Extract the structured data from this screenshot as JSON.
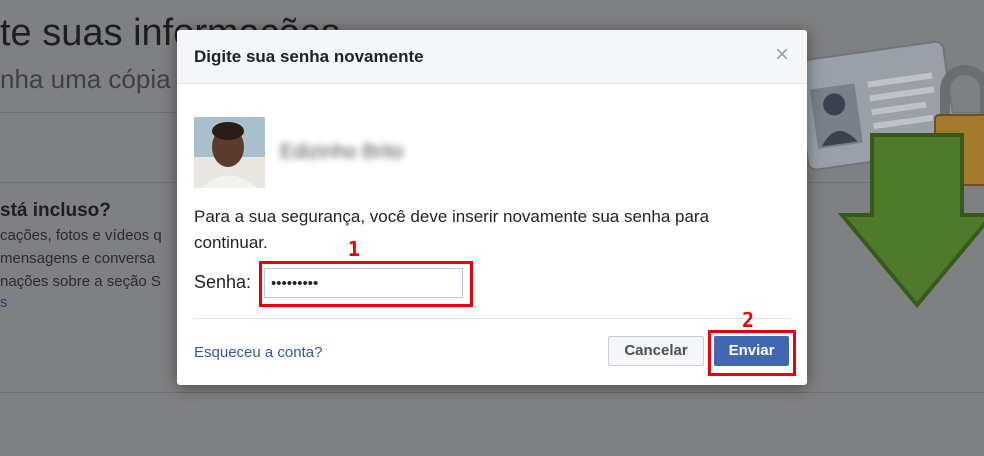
{
  "background": {
    "title": "te suas informações",
    "subtitle": "nha uma cópia",
    "section_heading": "stá incluso?",
    "lines": [
      "cações, fotos e vídeos q",
      "mensagens e conversa",
      "nações sobre a seção S"
    ],
    "link": "s"
  },
  "dialog": {
    "title": "Digite sua senha novamente",
    "close_symbol": "×",
    "user_name": "Edizinho Brito",
    "message": "Para a sua segurança, você deve inserir novamente sua senha para continuar.",
    "password_label": "Senha:",
    "password_value": "•••••••••",
    "forgot_link": "Esqueceu a conta?",
    "cancel_label": "Cancelar",
    "send_label": "Enviar"
  },
  "annotations": {
    "step1": "1",
    "step2": "2",
    "color": "#e8000b"
  },
  "colors": {
    "primary": "#4267b2",
    "link": "#365899"
  }
}
